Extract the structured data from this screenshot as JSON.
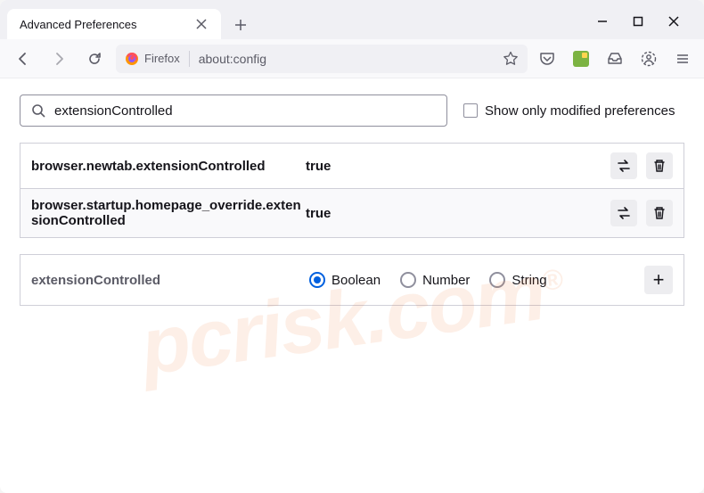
{
  "tab": {
    "title": "Advanced Preferences"
  },
  "urlbar": {
    "identity": "Firefox",
    "url": "about:config"
  },
  "search": {
    "value": "extensionControlled"
  },
  "modified_label": "Show only modified preferences",
  "prefs": [
    {
      "name": "browser.newtab.extensionControlled",
      "value": "true"
    },
    {
      "name": "browser.startup.homepage_override.extensionControlled",
      "value": "true"
    }
  ],
  "new_pref": {
    "name": "extensionControlled",
    "types": [
      {
        "label": "Boolean",
        "selected": true
      },
      {
        "label": "Number",
        "selected": false
      },
      {
        "label": "String",
        "selected": false
      }
    ]
  },
  "watermark": "pcrisk.com"
}
